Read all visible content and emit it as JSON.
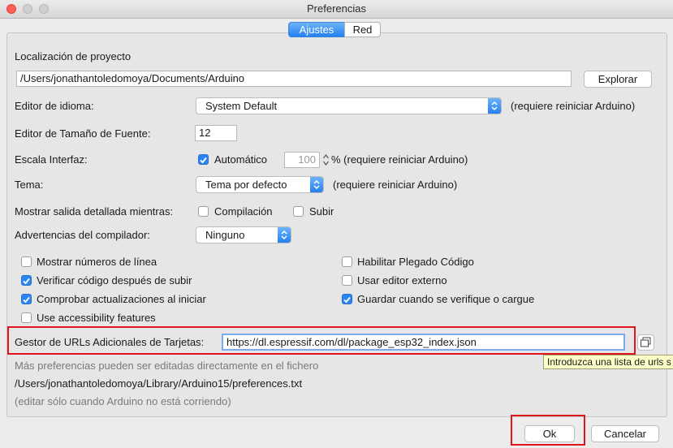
{
  "window": {
    "title": "Preferencias"
  },
  "tabs": {
    "ajustes": "Ajustes",
    "red": "Red"
  },
  "project": {
    "label": "Localización de proyecto",
    "path": "/Users/jonathantoledomoya/Documents/Arduino",
    "browse": "Explorar"
  },
  "language": {
    "label": "Editor de idioma:",
    "value": "System Default",
    "note": "(requiere reiniciar Arduino)"
  },
  "font_size": {
    "label": "Editor de Tamaño de Fuente:",
    "value": "12"
  },
  "scale": {
    "label": "Escala Interfaz:",
    "auto_label": "Automático",
    "value": "100",
    "percent_note": "% (requiere reiniciar Arduino)",
    "auto_checked": true
  },
  "theme": {
    "label": "Tema:",
    "value": "Tema por defecto",
    "note": "(requiere reiniciar Arduino)"
  },
  "verbose": {
    "label": "Mostrar salida detallada mientras:",
    "compile": "Compilación",
    "upload": "Subir",
    "compile_checked": false,
    "upload_checked": false
  },
  "warnings": {
    "label": "Advertencias del compilador:",
    "value": "Ninguno"
  },
  "options": {
    "line_numbers": {
      "label": "Mostrar números de línea",
      "checked": false
    },
    "verify_upload": {
      "label": "Verificar código después de subir",
      "checked": true
    },
    "check_updates": {
      "label": "Comprobar actualizaciones al iniciar",
      "checked": true
    },
    "accessibility": {
      "label": "Use accessibility features",
      "checked": false
    },
    "code_folding": {
      "label": "Habilitar Plegado Código",
      "checked": false
    },
    "external_editor": {
      "label": "Usar editor externo",
      "checked": false
    },
    "save_on_verify": {
      "label": "Guardar cuando se verifique o cargue",
      "checked": true
    }
  },
  "board_urls": {
    "label": "Gestor de URLs Adicionales de Tarjetas:",
    "value": "https://dl.espressif.com/dl/package_esp32_index.json"
  },
  "tooltip": "Introduzca una lista de urls s",
  "footer": {
    "more_prefs": "Más preferencias pueden ser editadas directamente en el fichero",
    "prefs_path": "/Users/jonathantoledomoya/Library/Arduino15/preferences.txt",
    "edit_note": "(editar sólo cuando Arduino no está corriendo)"
  },
  "buttons": {
    "ok": "Ok",
    "cancel": "Cancelar"
  },
  "colors": {
    "accent": "#2b86f3",
    "highlight": "#e0141e"
  }
}
